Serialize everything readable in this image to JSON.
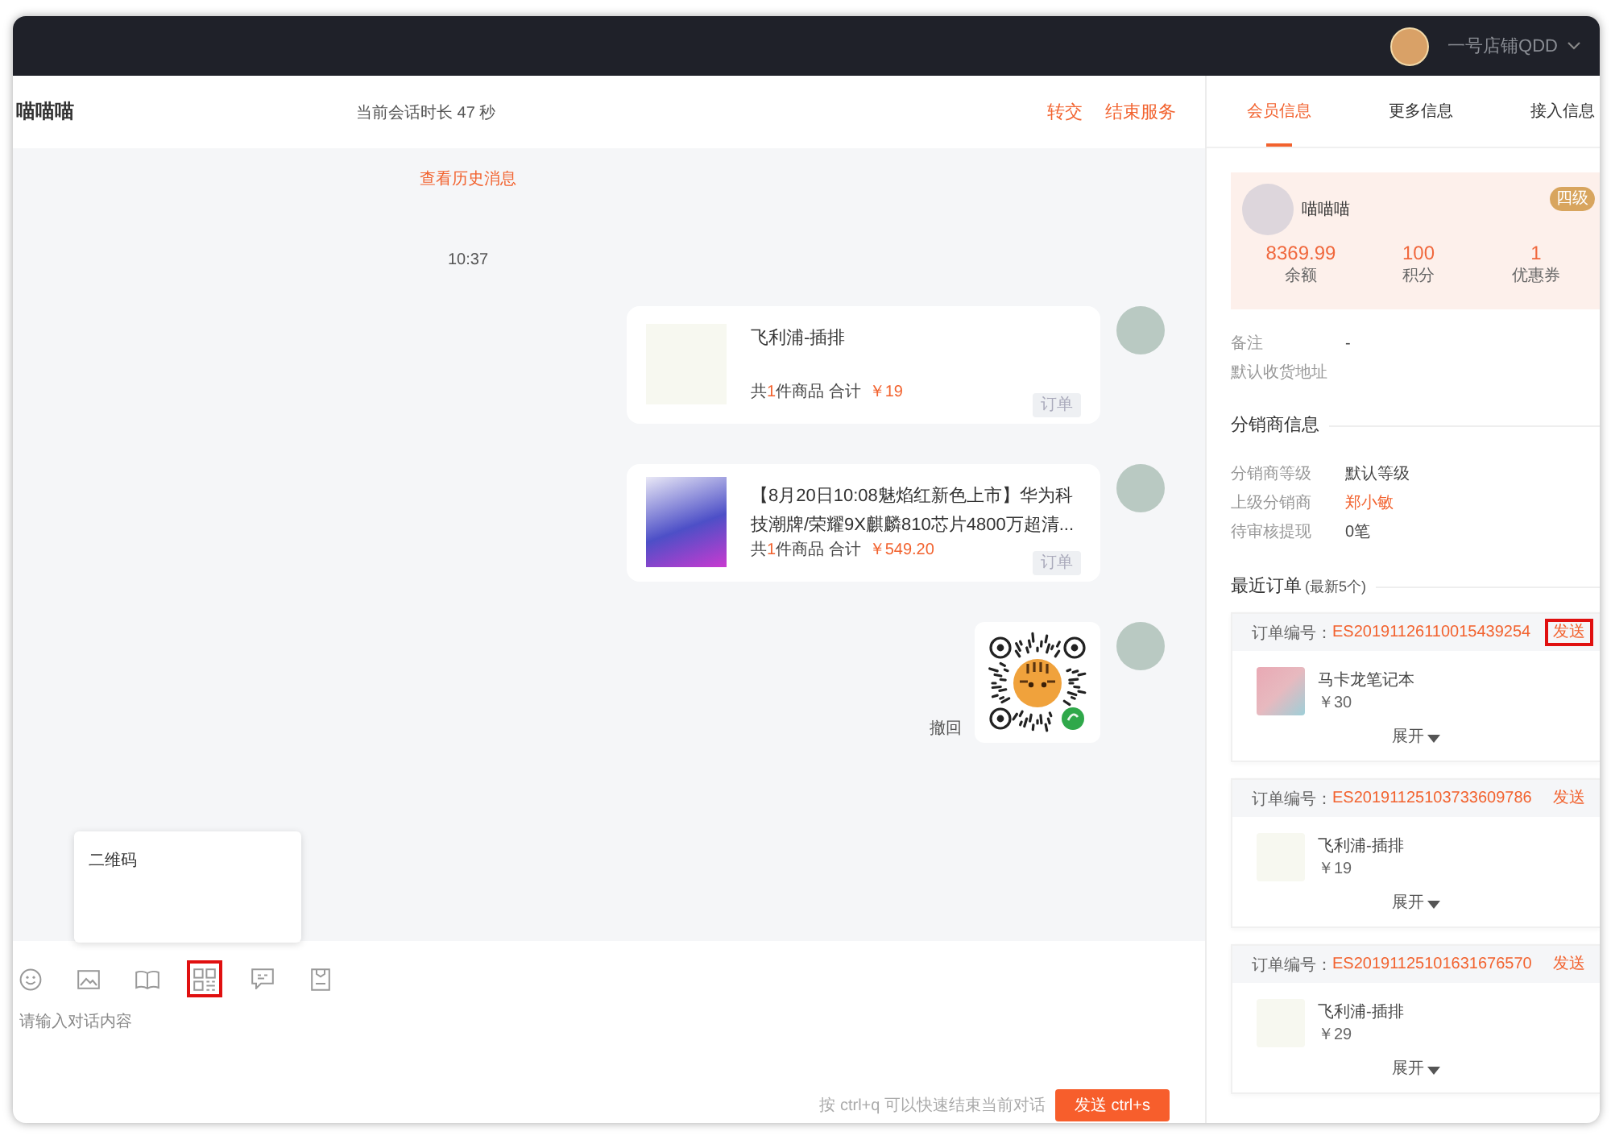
{
  "top_bar": {
    "store_name": "一号店铺QDD"
  },
  "chat": {
    "header": {
      "customer_name": "喵喵喵",
      "session_duration": "当前会话时长 47 秒",
      "actions": [
        "转交",
        "结束服务"
      ]
    },
    "history_link": "查看历史消息",
    "time": "10:37",
    "messages": [
      {
        "kind": "product",
        "image": {
          "kind": "logo"
        },
        "title": "飞利浦-插排",
        "summary_prefix": "共",
        "item_count": "1",
        "summary_suffix": "件商品 合计",
        "price": "￥19",
        "order_button": "订单"
      },
      {
        "kind": "product",
        "image": {
          "kind": "phone"
        },
        "title": "【8月20日10:08魅焰红新色上市】华为科技潮牌/荣耀9X麒麟810芯片4800万超清...",
        "summary_prefix": "共",
        "item_count": "1",
        "summary_suffix": "件商品 合计",
        "price": "￥549.20",
        "order_button": "订单"
      },
      {
        "kind": "qr_code",
        "recall": "撤回"
      }
    ],
    "popup": {
      "text": "二维码"
    },
    "toolbar": [
      {
        "kind": "emoji",
        "highlighted": false
      },
      {
        "kind": "image",
        "highlighted": false
      },
      {
        "kind": "book",
        "highlighted": false
      },
      {
        "kind": "qr_code",
        "highlighted": true
      },
      {
        "kind": "chat",
        "highlighted": false
      },
      {
        "kind": "clipboard",
        "highlighted": false
      }
    ],
    "input": {
      "placeholder": "请输入对话内容"
    },
    "hint": "按 ctrl+q 可以快速结束当前对话",
    "send_button": "发送 ctrl+s"
  },
  "side_panel": {
    "tabs": [
      {
        "label": "会员信息",
        "selected": true
      },
      {
        "label": "更多信息",
        "selected": false
      },
      {
        "label": "接入信息",
        "selected": false
      }
    ],
    "member": {
      "name": "喵喵喵",
      "grade": "四级",
      "stats": [
        {
          "value": "8369.99",
          "label": "余额"
        },
        {
          "value": "100",
          "label": "积分"
        },
        {
          "value": "1",
          "label": "优惠券"
        }
      ]
    },
    "details": [
      {
        "label": "备注",
        "value": "-"
      },
      {
        "label": "默认收货地址"
      }
    ],
    "distributor": {
      "title": "分销商信息",
      "rows": [
        {
          "label": "分销商等级",
          "value": "默认等级",
          "link": false
        },
        {
          "label": "上级分销商",
          "value": "郑小敏",
          "link": true
        },
        {
          "label": "待审核提现",
          "value": "0笔",
          "link": false
        }
      ]
    },
    "orders": {
      "title": "最近订单",
      "note": "(最新5个)",
      "items": [
        {
          "number_label": "订单编号：",
          "number": "ES20191126110015439254",
          "send": "发送",
          "highlighted": true,
          "product": {
            "image": {
              "kind": "notebook"
            },
            "name": "马卡龙笔记本",
            "price": "￥30"
          },
          "expand": "展开"
        },
        {
          "number_label": "订单编号：",
          "number": "ES20191125103733609786",
          "send": "发送",
          "highlighted": false,
          "product": {
            "image": {
              "kind": "logo"
            },
            "name": "飞利浦-插排",
            "price": "￥19"
          },
          "expand": "展开"
        },
        {
          "number_label": "订单编号：",
          "number": "ES20191125101631676570",
          "send": "发送",
          "highlighted": false,
          "product": {
            "image": {
              "kind": "logo"
            },
            "name": "飞利浦-插排",
            "price": "￥29"
          },
          "expand": "展开"
        }
      ]
    }
  }
}
